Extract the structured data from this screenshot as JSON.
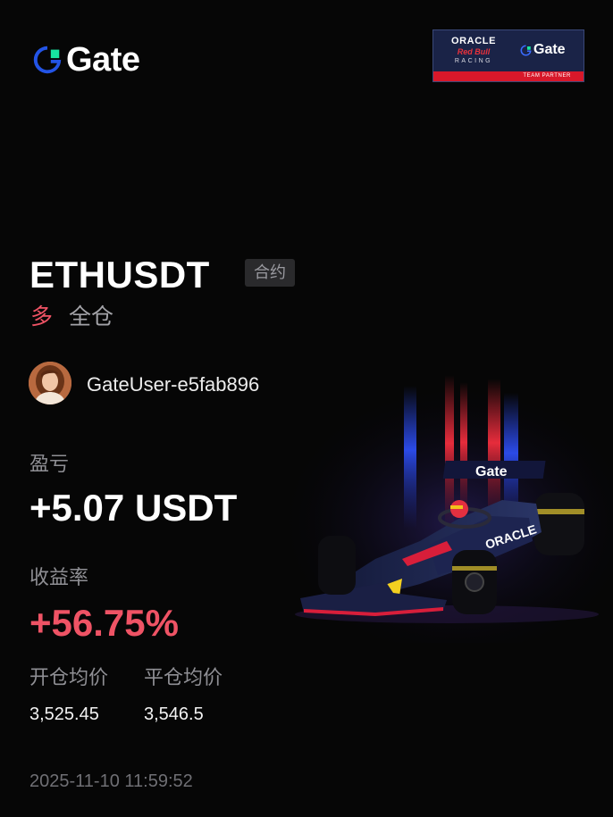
{
  "header": {
    "logo_text": "Gate",
    "partner": {
      "oracle": "ORACLE",
      "red_bull": "Red Bull",
      "racing": "RACING",
      "gate": "Gate",
      "team_partner": "TEAM PARTNER"
    }
  },
  "trade": {
    "symbol": "ETHUSDT",
    "type_tag": "合约",
    "side": "多",
    "margin_mode": "全仓"
  },
  "user": {
    "name": "GateUser-e5fab896"
  },
  "pnl": {
    "label": "盈亏",
    "value": "+5.07 USDT"
  },
  "roi": {
    "label": "收益率",
    "value": "+56.75%"
  },
  "prices": {
    "open_label": "开仓均价",
    "open_value": "3,525.45",
    "close_label": "平仓均价",
    "close_value": "3,546.5"
  },
  "timestamp": "2025-11-10 11:59:52",
  "car_livery_text": "Gate",
  "colors": {
    "background": "#060606",
    "accent_red": "#ef5365",
    "gate_blue": "#2354e6",
    "gate_green": "#17e6a1",
    "muted": "#8f8f94"
  },
  "icons": {
    "logo": "gate-logo-icon",
    "avatar": "user-avatar",
    "car": "race-car-illustration"
  }
}
